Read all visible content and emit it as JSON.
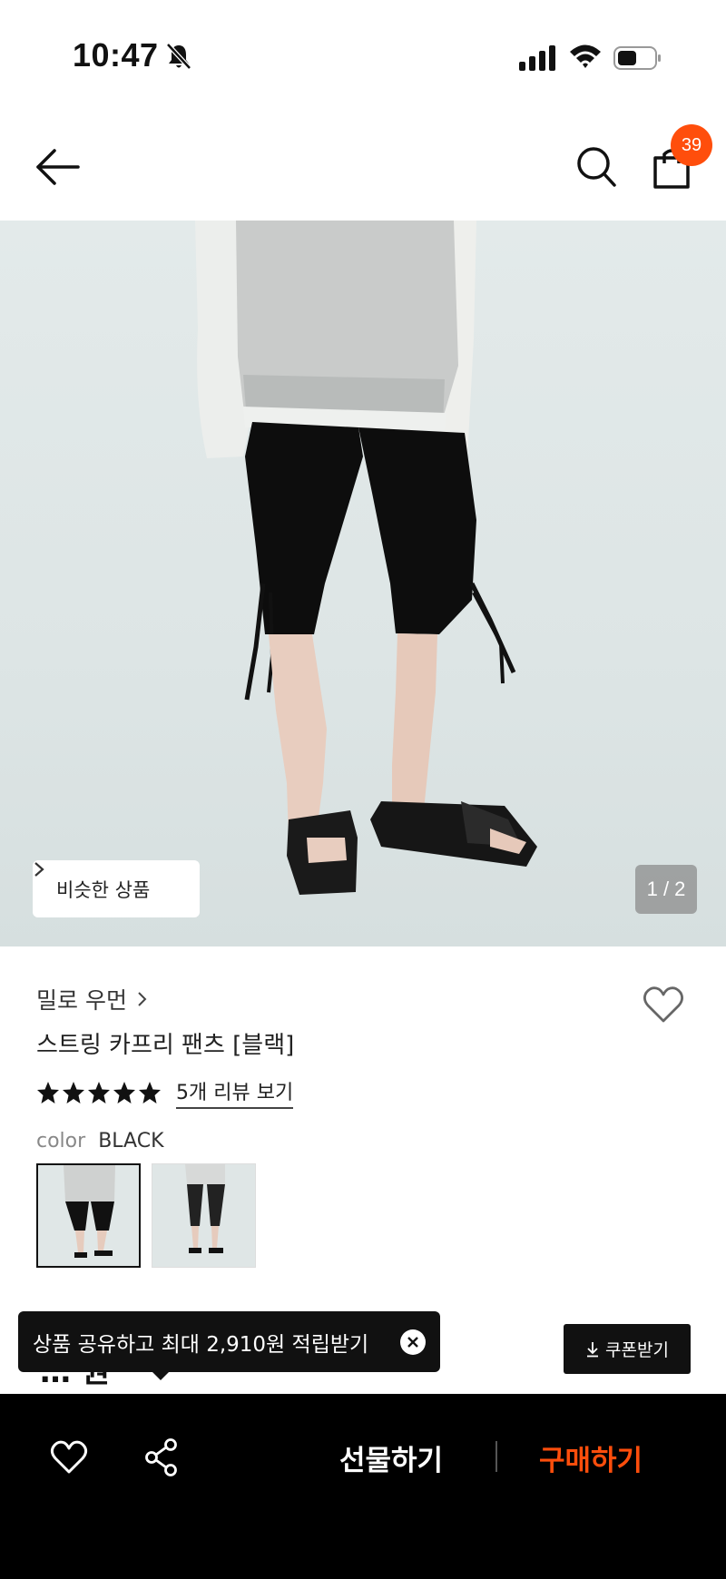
{
  "status_bar": {
    "time": "10:47"
  },
  "header": {
    "cart_count": "39"
  },
  "hero": {
    "similar_label": "비슷한 상품",
    "page_indicator": "1 / 2"
  },
  "product": {
    "brand": "밀로 우먼",
    "title": "스트링 카프리 팬츠 [블랙]",
    "rating_stars": 5,
    "review_link": "5개 리뷰 보기",
    "color_label": "color",
    "color_value": "BLACK",
    "price_fragment": "… 원"
  },
  "toast": {
    "text": "상품 공유하고 최대 2,910원 적립받기"
  },
  "coupon": {
    "label": "쿠폰받기"
  },
  "bottom_bar": {
    "gift_label": "선물하기",
    "buy_label": "구매하기",
    "accent_color": "#ff4e0c"
  }
}
